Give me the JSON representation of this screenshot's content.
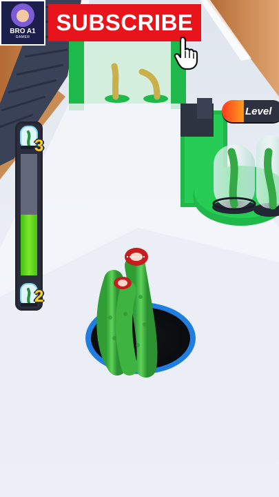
{
  "channel": {
    "name": "BRO A1",
    "subtitle": "GAMER"
  },
  "overlay": {
    "subscribe_label": "SUBSCRIBE"
  },
  "hud": {
    "level_label": "Level",
    "level_value": "",
    "meter": {
      "max_size": "3",
      "current_size": "2",
      "fill_fraction": 0.5
    }
  },
  "colors": {
    "subscribe_red": "#e8141b",
    "meter_green": "#6fd821",
    "hole_blue": "#1f7ee0",
    "tentacle_green": "#3db83d",
    "mouth_red": "#c41e1e"
  }
}
